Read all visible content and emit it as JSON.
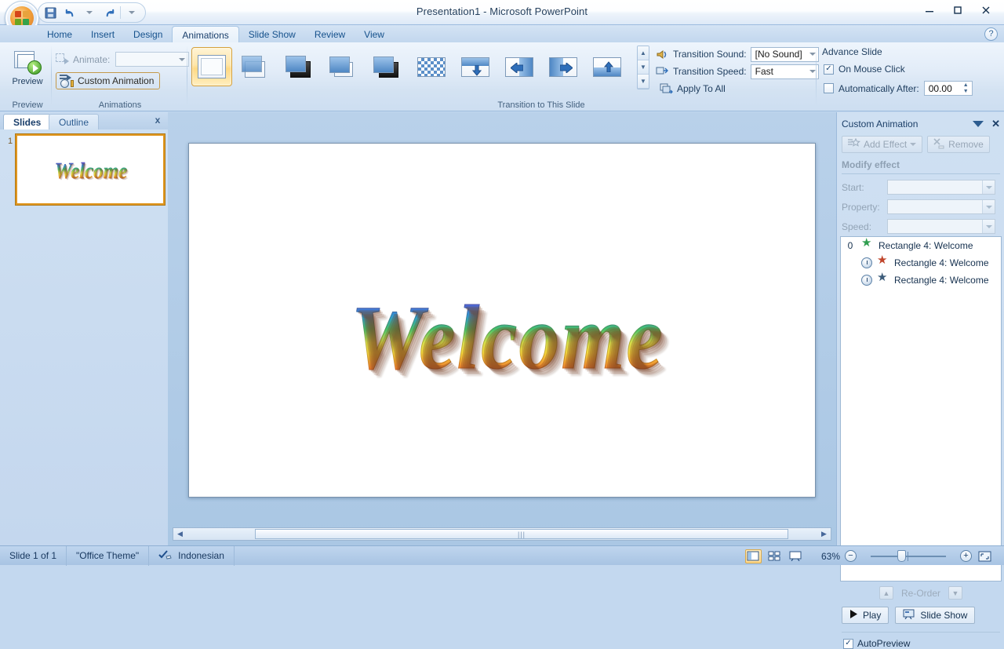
{
  "window": {
    "title": "Presentation1 - Microsoft PowerPoint",
    "minimize_label": "—",
    "maximize_label": "☐",
    "close_label": "✕",
    "help_label": "?"
  },
  "quick_access": {
    "save_icon": "save-icon",
    "undo_icon": "undo-icon",
    "redo_icon": "redo-icon",
    "more_icon": "chevron-down-icon"
  },
  "office_button": {
    "name": "office-orb"
  },
  "tabs": [
    {
      "label": "Home",
      "active": false
    },
    {
      "label": "Insert",
      "active": false
    },
    {
      "label": "Design",
      "active": false
    },
    {
      "label": "Animations",
      "active": true
    },
    {
      "label": "Slide Show",
      "active": false
    },
    {
      "label": "Review",
      "active": false
    },
    {
      "label": "View",
      "active": false
    }
  ],
  "ribbon": {
    "preview_group": {
      "label": "Preview",
      "button_label": "Preview"
    },
    "animations_group": {
      "label": "Animations",
      "animate_label": "Animate:",
      "animate_value": "",
      "custom_animation_label": "Custom Animation"
    },
    "transition_group": {
      "label": "Transition to This Slide",
      "gallery": [
        {
          "name": "no-transition",
          "selected": true
        },
        {
          "name": "cut-transition",
          "selected": false
        },
        {
          "name": "cut-through-black",
          "selected": false
        },
        {
          "name": "fade-smoothly",
          "selected": false
        },
        {
          "name": "fade-through-black",
          "selected": false
        },
        {
          "name": "checkerboard-across",
          "selected": false
        },
        {
          "name": "blinds-down",
          "selected": false
        },
        {
          "name": "wipe-left",
          "selected": false
        },
        {
          "name": "wipe-right",
          "selected": false
        },
        {
          "name": "wipe-up",
          "selected": false
        }
      ],
      "sound_label": "Transition Sound:",
      "sound_value": "[No Sound]",
      "speed_label": "Transition Speed:",
      "speed_value": "Fast",
      "apply_to_all_label": "Apply To All"
    },
    "advance_group": {
      "title": "Advance Slide",
      "on_mouse_click_label": "On Mouse Click",
      "on_mouse_click_checked": true,
      "automatically_after_label": "Automatically After:",
      "automatically_after_checked": false,
      "automatically_after_value": "00.00"
    }
  },
  "left_pane": {
    "tab_slides": "Slides",
    "tab_outline": "Outline",
    "close_label": "x",
    "slide_number": "1",
    "slide_text": "Welcome"
  },
  "slide": {
    "wordart_text": "Welcome"
  },
  "custom_animation": {
    "title": "Custom Animation",
    "close_label": "✕",
    "add_effect_label": "Add Effect",
    "remove_label": "Remove",
    "modify_effect_label": "Modify effect",
    "fields": [
      {
        "label": "Start:",
        "value": ""
      },
      {
        "label": "Property:",
        "value": ""
      },
      {
        "label": "Speed:",
        "value": ""
      }
    ],
    "items": [
      {
        "index": "0",
        "icon": "green-star-icon",
        "icon_color": "#2f9e4f",
        "trigger": "",
        "label": "Rectangle 4: Welcome"
      },
      {
        "index": "",
        "icon": "red-star-icon",
        "icon_color": "#c0452b",
        "trigger": "clock-icon",
        "label": "Rectangle 4: Welcome"
      },
      {
        "index": "",
        "icon": "grey-star-icon",
        "icon_color": "#3d5c7a",
        "trigger": "clock-icon",
        "label": "Rectangle 4: Welcome"
      }
    ],
    "reorder_label": "Re-Order",
    "play_label": "Play",
    "slide_show_label": "Slide Show",
    "autopreview_label": "AutoPreview",
    "autopreview_checked": true
  },
  "status_bar": {
    "slide_count": "Slide 1 of 1",
    "theme": "\"Office Theme\"",
    "language": "Indonesian",
    "zoom_level": "63%",
    "zoom_out_label": "−",
    "zoom_in_label": "+",
    "view_normal": "normal-view-icon",
    "view_sorter": "slide-sorter-icon",
    "view_show": "slide-show-icon",
    "fit_window": "fit-to-window-icon"
  },
  "colors": {
    "accent": "#e0961f",
    "ribbon_bg": "#dbe8f6",
    "chrome": "#c3d8ef"
  }
}
